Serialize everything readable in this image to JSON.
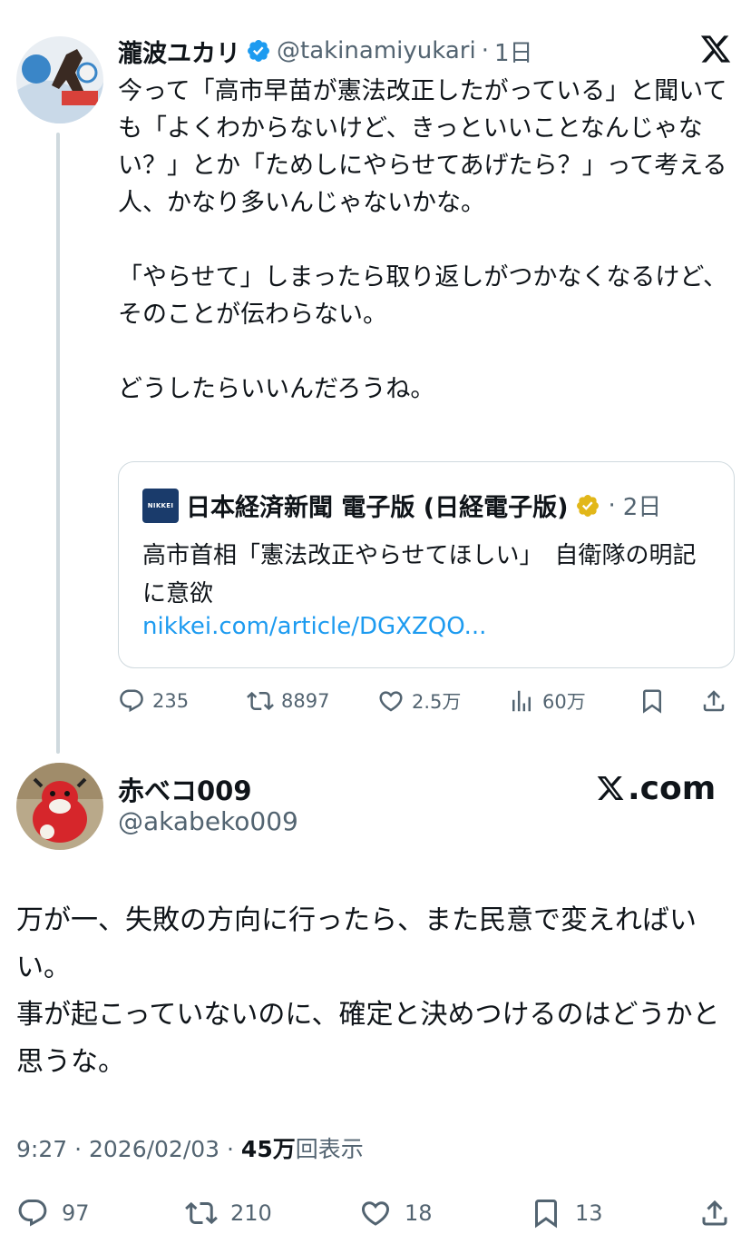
{
  "quoted_tweet": {
    "author_name": "瀧波ユカリ",
    "author_handle": "@takinamiyukari",
    "separator": "·",
    "time_ago": "1日",
    "body_lines": [
      "今って「高市早苗が憲法改正したがっている」と聞いても「よくわからないけど、きっといいことなんじゃない？」とか「ためしにやらせてあげたら？」って考える人、かなり多いんじゃないかな。",
      "",
      "「やらせて」しまったら取り返しがつかなくなるけど、そのことが伝わらない。",
      "",
      "どうしたらいいんだろうね。"
    ],
    "embedded": {
      "logo_text": "NIKKEI",
      "author_name": "日本経済新聞 電子版 (日経電子版)",
      "separator": "·",
      "time_ago": "2日",
      "text": "高市首相「憲法改正やらせてほしい」　自衛隊の明記に意欲",
      "link": "nikkei.com/article/DGXZQO..."
    },
    "actions": {
      "replies": "235",
      "reposts": "8897",
      "likes": "2.5万",
      "views": "60万"
    }
  },
  "main_tweet": {
    "author_name": "赤べコ009",
    "author_handle": "@akabeko009",
    "watermark": ".com",
    "body_lines": [
      "万が一、失敗の方向に行ったら、また民意で変えればいい。",
      "事が起こっていないのに、確定と決めつけるのはどうかと思うな。"
    ],
    "meta": {
      "time": "9:27",
      "separator1": " · ",
      "date": "2026/02/03",
      "separator2": " · ",
      "views_count": "45万",
      "views_label": "回表示"
    },
    "actions": {
      "replies": "97",
      "reposts": "210",
      "likes": "18",
      "bookmarks": "13"
    }
  },
  "colors": {
    "text": "#0f1419",
    "muted": "#536471",
    "link": "#1d9bf0",
    "verified_blue": "#1d9bf0",
    "verified_gold": "#e2b719",
    "border": "#cfd9de"
  },
  "icons": [
    "verified-badge-icon",
    "x-logo-icon",
    "nikkei-logo",
    "gold-badge-icon",
    "reply-icon",
    "repost-icon",
    "like-icon",
    "views-icon",
    "bookmark-icon",
    "share-icon"
  ]
}
